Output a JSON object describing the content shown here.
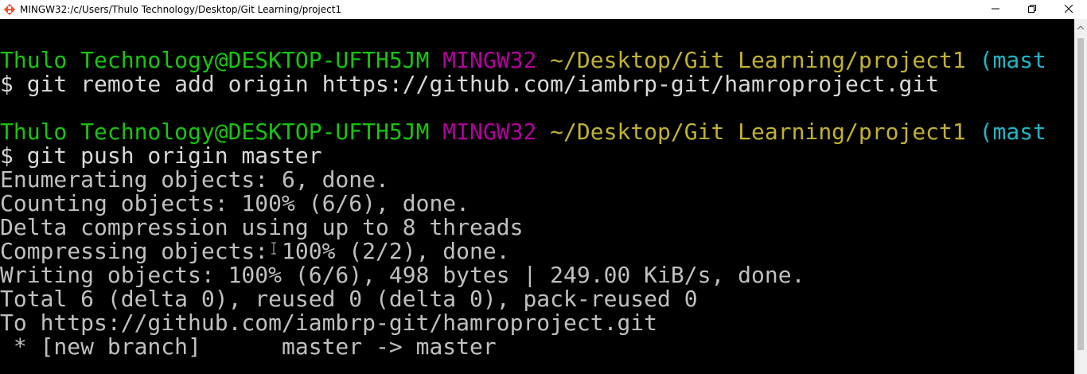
{
  "window": {
    "title": "MINGW32:/c/Users/Thulo Technology/Desktop/Git Learning/project1",
    "app_icon": "git-bash-icon",
    "controls": [
      "minimize-icon",
      "maximize-icon",
      "close-icon"
    ]
  },
  "terminal": {
    "prompt_1": {
      "user": "Thulo Technology@DESKTOP-UFTH5JM",
      "system": "MINGW32",
      "path": "~/Desktop/Git Learning/project1",
      "branch": "(mast"
    },
    "command_1": "$ git remote add origin https://github.com/iambrp-git/hamroproject.git",
    "prompt_2": {
      "user": "Thulo Technology@DESKTOP-UFTH5JM",
      "system": "MINGW32",
      "path": "~/Desktop/Git Learning/project1",
      "branch": "(mast"
    },
    "command_2": "$ git push origin master",
    "output": [
      "Enumerating objects: 6, done.",
      "Counting objects: 100% (6/6), done.",
      "Delta compression using up to 8 threads",
      "Compressing objects: 100% (2/2), done.",
      "Writing objects: 100% (6/6), 498 bytes | 249.00 KiB/s, done.",
      "Total 6 (delta 0), reused 0 (delta 0), pack-reused 0",
      "To https://github.com/iambrp-git/hamroproject.git",
      " * [new branch]      master -> master"
    ]
  },
  "colors": {
    "background": "#000000",
    "text": "#c0c0c0",
    "user_host": "#16c60c",
    "system": "#b4009e",
    "path": "#c1b22f",
    "branch": "#1fb6c4"
  }
}
